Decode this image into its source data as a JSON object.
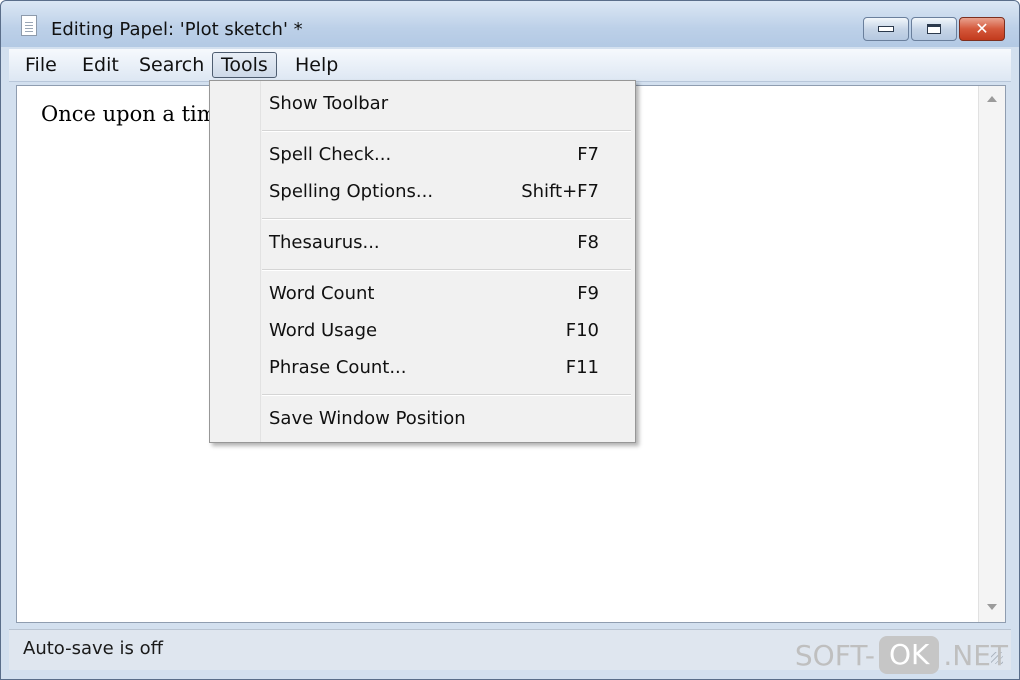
{
  "window": {
    "title": "Editing Papel: 'Plot sketch' *",
    "icon": "document-icon",
    "controls": [
      "minimize-icon",
      "maximize-icon",
      "close-icon"
    ]
  },
  "menubar": {
    "items": [
      "File",
      "Edit",
      "Search",
      "Tools",
      "Help"
    ],
    "active": "Tools"
  },
  "editor": {
    "text": "Once upon a time"
  },
  "tools_menu": {
    "items": [
      {
        "label": "Show Toolbar",
        "shortcut": ""
      },
      {
        "label": "Spell Check...",
        "shortcut": "F7"
      },
      {
        "label": "Spelling Options...",
        "shortcut": "Shift+F7"
      },
      {
        "label": "Thesaurus...",
        "shortcut": "F8"
      },
      {
        "label": "Word Count",
        "shortcut": "F9"
      },
      {
        "label": "Word Usage",
        "shortcut": "F10"
      },
      {
        "label": "Phrase Count...",
        "shortcut": "F11"
      },
      {
        "label": "Save Window Position",
        "shortcut": ""
      }
    ]
  },
  "statusbar": {
    "text": "Auto-save is off"
  },
  "watermark": {
    "left": "SOFT-",
    "middle": "OK",
    "right": ".NET"
  },
  "colors": {
    "title_bar": "#bcd0e8",
    "close_button": "#d4583b",
    "menu_background": "#f1f1f1"
  }
}
